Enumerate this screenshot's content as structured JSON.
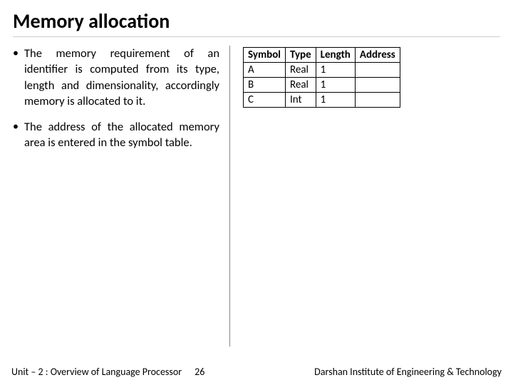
{
  "title": "Memory allocation",
  "bullets": [
    "The memory requirement of an identifier is computed from its type, length and dimensionality, accordingly memory is allocated to it.",
    "The address of the allocated memory area is entered in the symbol table."
  ],
  "chart_data": {
    "type": "table",
    "headers": [
      "Symbol",
      "Type",
      "Length",
      "Address"
    ],
    "rows": [
      [
        "A",
        "Real",
        "1",
        ""
      ],
      [
        "B",
        "Real",
        "1",
        ""
      ],
      [
        "C",
        "Int",
        "1",
        ""
      ]
    ]
  },
  "footer": {
    "unit": "Unit – 2 : Overview of Language Processor",
    "page": "26",
    "institute": "Darshan Institute of Engineering & Technology"
  }
}
